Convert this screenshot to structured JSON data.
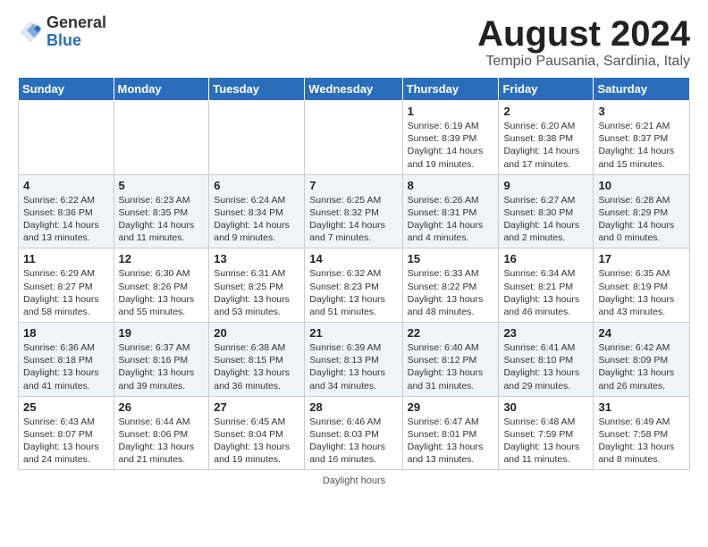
{
  "logo": {
    "general": "General",
    "blue": "Blue"
  },
  "title": "August 2024",
  "subtitle": "Tempio Pausania, Sardinia, Italy",
  "days_of_week": [
    "Sunday",
    "Monday",
    "Tuesday",
    "Wednesday",
    "Thursday",
    "Friday",
    "Saturday"
  ],
  "weeks": [
    [
      {
        "day": "",
        "info": ""
      },
      {
        "day": "",
        "info": ""
      },
      {
        "day": "",
        "info": ""
      },
      {
        "day": "",
        "info": ""
      },
      {
        "day": "1",
        "info": "Sunrise: 6:19 AM\nSunset: 8:39 PM\nDaylight: 14 hours and 19 minutes."
      },
      {
        "day": "2",
        "info": "Sunrise: 6:20 AM\nSunset: 8:38 PM\nDaylight: 14 hours and 17 minutes."
      },
      {
        "day": "3",
        "info": "Sunrise: 6:21 AM\nSunset: 8:37 PM\nDaylight: 14 hours and 15 minutes."
      }
    ],
    [
      {
        "day": "4",
        "info": "Sunrise: 6:22 AM\nSunset: 8:36 PM\nDaylight: 14 hours and 13 minutes."
      },
      {
        "day": "5",
        "info": "Sunrise: 6:23 AM\nSunset: 8:35 PM\nDaylight: 14 hours and 11 minutes."
      },
      {
        "day": "6",
        "info": "Sunrise: 6:24 AM\nSunset: 8:34 PM\nDaylight: 14 hours and 9 minutes."
      },
      {
        "day": "7",
        "info": "Sunrise: 6:25 AM\nSunset: 8:32 PM\nDaylight: 14 hours and 7 minutes."
      },
      {
        "day": "8",
        "info": "Sunrise: 6:26 AM\nSunset: 8:31 PM\nDaylight: 14 hours and 4 minutes."
      },
      {
        "day": "9",
        "info": "Sunrise: 6:27 AM\nSunset: 8:30 PM\nDaylight: 14 hours and 2 minutes."
      },
      {
        "day": "10",
        "info": "Sunrise: 6:28 AM\nSunset: 8:29 PM\nDaylight: 14 hours and 0 minutes."
      }
    ],
    [
      {
        "day": "11",
        "info": "Sunrise: 6:29 AM\nSunset: 8:27 PM\nDaylight: 13 hours and 58 minutes."
      },
      {
        "day": "12",
        "info": "Sunrise: 6:30 AM\nSunset: 8:26 PM\nDaylight: 13 hours and 55 minutes."
      },
      {
        "day": "13",
        "info": "Sunrise: 6:31 AM\nSunset: 8:25 PM\nDaylight: 13 hours and 53 minutes."
      },
      {
        "day": "14",
        "info": "Sunrise: 6:32 AM\nSunset: 8:23 PM\nDaylight: 13 hours and 51 minutes."
      },
      {
        "day": "15",
        "info": "Sunrise: 6:33 AM\nSunset: 8:22 PM\nDaylight: 13 hours and 48 minutes."
      },
      {
        "day": "16",
        "info": "Sunrise: 6:34 AM\nSunset: 8:21 PM\nDaylight: 13 hours and 46 minutes."
      },
      {
        "day": "17",
        "info": "Sunrise: 6:35 AM\nSunset: 8:19 PM\nDaylight: 13 hours and 43 minutes."
      }
    ],
    [
      {
        "day": "18",
        "info": "Sunrise: 6:36 AM\nSunset: 8:18 PM\nDaylight: 13 hours and 41 minutes."
      },
      {
        "day": "19",
        "info": "Sunrise: 6:37 AM\nSunset: 8:16 PM\nDaylight: 13 hours and 39 minutes."
      },
      {
        "day": "20",
        "info": "Sunrise: 6:38 AM\nSunset: 8:15 PM\nDaylight: 13 hours and 36 minutes."
      },
      {
        "day": "21",
        "info": "Sunrise: 6:39 AM\nSunset: 8:13 PM\nDaylight: 13 hours and 34 minutes."
      },
      {
        "day": "22",
        "info": "Sunrise: 6:40 AM\nSunset: 8:12 PM\nDaylight: 13 hours and 31 minutes."
      },
      {
        "day": "23",
        "info": "Sunrise: 6:41 AM\nSunset: 8:10 PM\nDaylight: 13 hours and 29 minutes."
      },
      {
        "day": "24",
        "info": "Sunrise: 6:42 AM\nSunset: 8:09 PM\nDaylight: 13 hours and 26 minutes."
      }
    ],
    [
      {
        "day": "25",
        "info": "Sunrise: 6:43 AM\nSunset: 8:07 PM\nDaylight: 13 hours and 24 minutes."
      },
      {
        "day": "26",
        "info": "Sunrise: 6:44 AM\nSunset: 8:06 PM\nDaylight: 13 hours and 21 minutes."
      },
      {
        "day": "27",
        "info": "Sunrise: 6:45 AM\nSunset: 8:04 PM\nDaylight: 13 hours and 19 minutes."
      },
      {
        "day": "28",
        "info": "Sunrise: 6:46 AM\nSunset: 8:03 PM\nDaylight: 13 hours and 16 minutes."
      },
      {
        "day": "29",
        "info": "Sunrise: 6:47 AM\nSunset: 8:01 PM\nDaylight: 13 hours and 13 minutes."
      },
      {
        "day": "30",
        "info": "Sunrise: 6:48 AM\nSunset: 7:59 PM\nDaylight: 13 hours and 11 minutes."
      },
      {
        "day": "31",
        "info": "Sunrise: 6:49 AM\nSunset: 7:58 PM\nDaylight: 13 hours and 8 minutes."
      }
    ]
  ],
  "footer": "Daylight hours"
}
